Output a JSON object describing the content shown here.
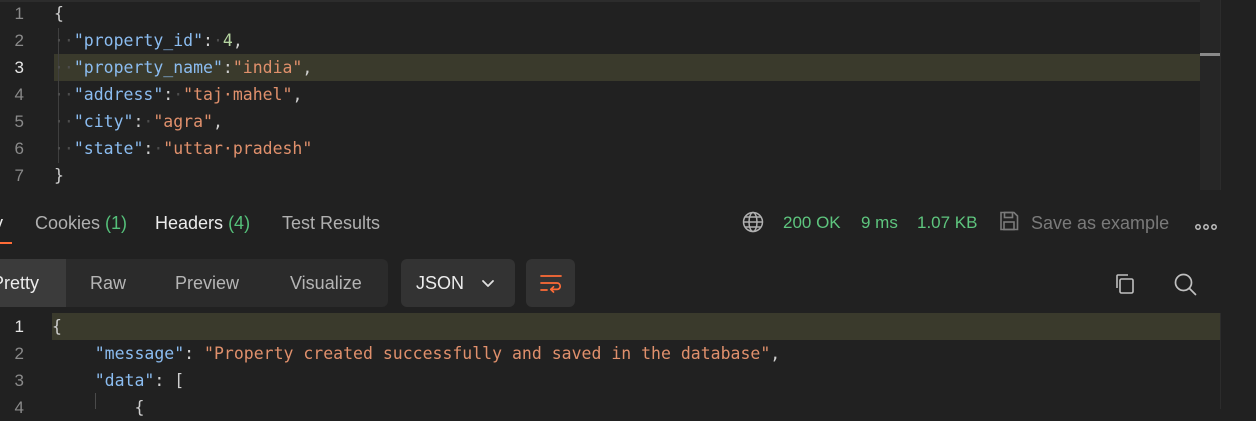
{
  "request_body": {
    "line_numbers": [
      "1",
      "2",
      "3",
      "4",
      "5",
      "6",
      "7"
    ],
    "lines": [
      [
        {
          "t": "p",
          "v": "{"
        }
      ],
      [
        {
          "t": "w",
          "v": "··"
        },
        {
          "t": "k",
          "v": "\"property_id\""
        },
        {
          "t": "p",
          "v": ":"
        },
        {
          "t": "w",
          "v": "·"
        },
        {
          "t": "n",
          "v": "4"
        },
        {
          "t": "p",
          "v": ","
        }
      ],
      [
        {
          "t": "w",
          "v": "··"
        },
        {
          "t": "k",
          "v": "\"property_name\""
        },
        {
          "t": "p",
          "v": ":"
        },
        {
          "t": "s",
          "v": "\"india\""
        },
        {
          "t": "p",
          "v": ","
        }
      ],
      [
        {
          "t": "w",
          "v": "··"
        },
        {
          "t": "k",
          "v": "\"address\""
        },
        {
          "t": "p",
          "v": ":"
        },
        {
          "t": "w",
          "v": "·"
        },
        {
          "t": "s",
          "v": "\"taj·mahel\""
        },
        {
          "t": "p",
          "v": ","
        }
      ],
      [
        {
          "t": "w",
          "v": "··"
        },
        {
          "t": "k",
          "v": "\"city\""
        },
        {
          "t": "p",
          "v": ":"
        },
        {
          "t": "w",
          "v": "·"
        },
        {
          "t": "s",
          "v": "\"agra\""
        },
        {
          "t": "p",
          "v": ","
        }
      ],
      [
        {
          "t": "w",
          "v": "··"
        },
        {
          "t": "k",
          "v": "\"state\""
        },
        {
          "t": "p",
          "v": ":"
        },
        {
          "t": "w",
          "v": "·"
        },
        {
          "t": "s",
          "v": "\"uttar·pradesh\""
        }
      ],
      [
        {
          "t": "p",
          "v": "}"
        }
      ]
    ]
  },
  "response_tabs": {
    "body": "y",
    "cookies": "Cookies",
    "cookies_count": "(1)",
    "headers": "Headers",
    "headers_count": "(4)",
    "test_results": "Test Results"
  },
  "response_meta": {
    "status": "200 OK",
    "time": "9 ms",
    "size": "1.07 KB",
    "save_as_example": "Save as example"
  },
  "view_modes": {
    "pretty": "Pretty",
    "raw": "Raw",
    "preview": "Preview",
    "visualize": "Visualize"
  },
  "format_select": {
    "value": "JSON"
  },
  "response_body": {
    "line_numbers": [
      "1",
      "2",
      "3",
      "4"
    ],
    "lines": [
      [
        {
          "t": "p",
          "v": "{"
        }
      ],
      [
        {
          "t": "p",
          "v": "    "
        },
        {
          "t": "k",
          "v": "\"message\""
        },
        {
          "t": "p",
          "v": ": "
        },
        {
          "t": "s",
          "v": "\"Property created successfully and saved in the database\""
        },
        {
          "t": "p",
          "v": ","
        }
      ],
      [
        {
          "t": "p",
          "v": "    "
        },
        {
          "t": "k",
          "v": "\"data\""
        },
        {
          "t": "p",
          "v": ": ["
        }
      ],
      [
        {
          "t": "p",
          "v": "        {"
        }
      ]
    ]
  },
  "colors": {
    "background": "#212121",
    "accent": "#ff6c37",
    "success": "#5ec57e",
    "json_key": "#8bbcf0",
    "json_string": "#e0906c",
    "json_number": "#b5d4a0"
  },
  "icons": [
    "globe-icon",
    "save-icon",
    "more-icon",
    "chevron-down-icon",
    "wrap-lines-icon",
    "copy-icon",
    "search-icon"
  ]
}
